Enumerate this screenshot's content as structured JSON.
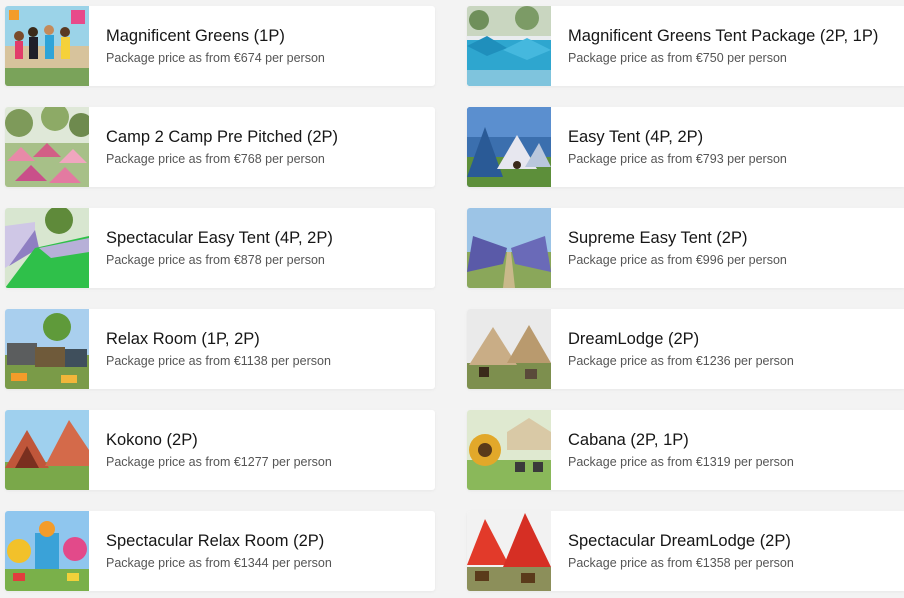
{
  "packages": [
    {
      "title": "Magnificent Greens (1P)",
      "price_text": "Package price as from €674 per person",
      "thumb_icon": "festival-crowd-photo"
    },
    {
      "title": "Magnificent Greens Tent Package (2P, 1P)",
      "price_text": "Package price as from €750 per person",
      "thumb_icon": "blue-tents-photo"
    },
    {
      "title": "Camp 2 Camp Pre Pitched (2P)",
      "price_text": "Package price as from €768 per person",
      "thumb_icon": "pink-tents-photo"
    },
    {
      "title": "Easy Tent (4P, 2P)",
      "price_text": "Package price as from €793 per person",
      "thumb_icon": "easy-tent-photo"
    },
    {
      "title": "Spectacular Easy Tent (4P, 2P)",
      "price_text": "Package price as from €878 per person",
      "thumb_icon": "green-carpet-tents-photo"
    },
    {
      "title": "Supreme Easy Tent (2P)",
      "price_text": "Package price as from €996 per person",
      "thumb_icon": "tent-row-photo"
    },
    {
      "title": "Relax Room (1P, 2P)",
      "price_text": "Package price as from €1138 per person",
      "thumb_icon": "relax-room-photo"
    },
    {
      "title": "DreamLodge (2P)",
      "price_text": "Package price as from €1236 per person",
      "thumb_icon": "dreamlodge-photo"
    },
    {
      "title": "Kokono (2P)",
      "price_text": "Package price as from €1277 per person",
      "thumb_icon": "kokono-tent-photo"
    },
    {
      "title": "Cabana (2P, 1P)",
      "price_text": "Package price as from €1319 per person",
      "thumb_icon": "cabana-photo"
    },
    {
      "title": "Spectacular Relax Room (2P)",
      "price_text": "Package price as from €1344 per person",
      "thumb_icon": "colorful-decor-photo"
    },
    {
      "title": "Spectacular DreamLodge (2P)",
      "price_text": "Package price as from €1358 per person",
      "thumb_icon": "red-lodge-photo"
    }
  ]
}
